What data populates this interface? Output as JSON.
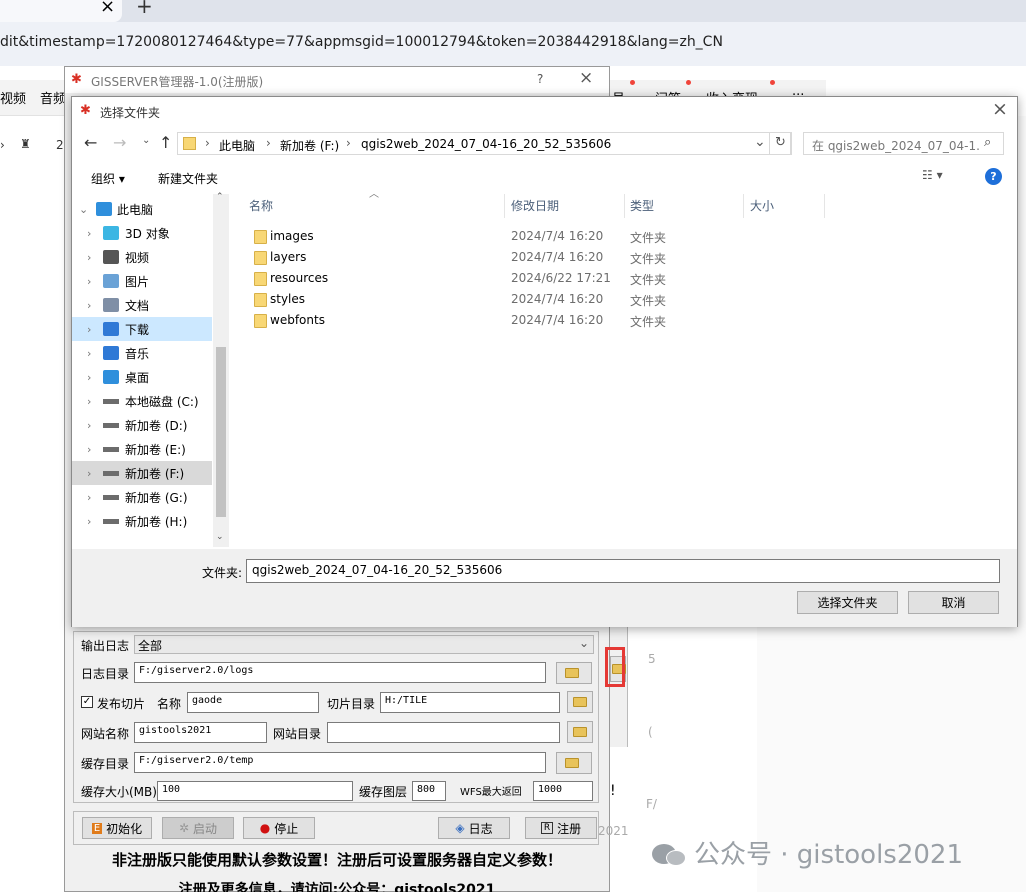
{
  "browser": {
    "tab_close": "×",
    "new_tab": "+",
    "url": "dit&timestamp=1720080127464&type=77&appmsgid=100012794&token=2038442918&lang=zh_CN",
    "nav_left": [
      "视频",
      "音频"
    ],
    "nav_right": [
      "号",
      "问答",
      "收入变现",
      "···"
    ],
    "toolbar_num": "2"
  },
  "gisserver": {
    "title": "GISSERVER管理器-1.0(注册版)",
    "help": "?",
    "close": "×",
    "log_output_label": "输出日志",
    "log_output_value": "全部",
    "log_dir_label": "日志目录",
    "log_dir_value": "F:/giserver2.0/logs",
    "publish_tiles_label": "发布切片",
    "name_label": "名称",
    "name_value": "gaode",
    "tile_dir_label": "切片目录",
    "tile_dir_value": "H:/TILE",
    "site_name_label": "网站名称",
    "site_name_value": "gistools2021",
    "site_dir_label": "网站目录",
    "site_dir_value": "",
    "cache_dir_label": "缓存目录",
    "cache_dir_value": "F:/giserver2.0/temp",
    "cache_size_label": "缓存大小(MB)",
    "cache_size_value": "100",
    "cache_layers_label": "缓存图层",
    "cache_layers_value": "800",
    "wfs_max_label": "WFS最大返回",
    "wfs_max_value": "1000",
    "btn_init": "初始化",
    "btn_start": "启动",
    "btn_stop": "停止",
    "btn_log": "日志",
    "btn_register": "注册",
    "notice": "非注册版只能使用默认参数设置！注册后可设置服务器自定义参数！",
    "notice2": "注册及更多信息，请访问:公众号：gistools2021"
  },
  "dialog": {
    "title": "选择文件夹",
    "close": "×",
    "breadcrumb": [
      "此电脑",
      "新加卷 (F:)",
      "qgis2web_2024_07_04-16_20_52_535606"
    ],
    "search_placeholder": "在 qgis2web_2024_07_04-1...",
    "organize": "组织",
    "new_folder": "新建文件夹",
    "help": "?",
    "tree": [
      {
        "label": "此电脑",
        "icon": "computer-icon"
      },
      {
        "label": "3D 对象",
        "icon": "cube-icon"
      },
      {
        "label": "视频",
        "icon": "video-icon"
      },
      {
        "label": "图片",
        "icon": "picture-icon"
      },
      {
        "label": "文档",
        "icon": "document-icon"
      },
      {
        "label": "下载",
        "icon": "download-icon"
      },
      {
        "label": "音乐",
        "icon": "music-icon"
      },
      {
        "label": "桌面",
        "icon": "desktop-icon"
      },
      {
        "label": "本地磁盘 (C:)",
        "icon": "drive-icon"
      },
      {
        "label": "新加卷 (D:)",
        "icon": "drive-icon"
      },
      {
        "label": "新加卷 (E:)",
        "icon": "drive-icon"
      },
      {
        "label": "新加卷 (F:)",
        "icon": "drive-icon"
      },
      {
        "label": "新加卷 (G:)",
        "icon": "drive-icon"
      },
      {
        "label": "新加卷 (H:)",
        "icon": "drive-icon"
      }
    ],
    "columns": {
      "name": "名称",
      "date": "修改日期",
      "type": "类型",
      "size": "大小"
    },
    "files": [
      {
        "name": "images",
        "date": "2024/7/4 16:20",
        "type": "文件夹"
      },
      {
        "name": "layers",
        "date": "2024/7/4 16:20",
        "type": "文件夹"
      },
      {
        "name": "resources",
        "date": "2024/6/22 17:21",
        "type": "文件夹"
      },
      {
        "name": "styles",
        "date": "2024/7/4 16:20",
        "type": "文件夹"
      },
      {
        "name": "webfonts",
        "date": "2024/7/4 16:20",
        "type": "文件夹"
      }
    ],
    "folder_label": "文件夹:",
    "folder_value": "qgis2web_2024_07_04-16_20_52_535606",
    "select_button": "选择文件夹",
    "cancel_button": "取消"
  },
  "background": {
    "side_num": "2021",
    "right_snips": [
      "5",
      "(",
      "!",
      "F/"
    ]
  },
  "watermark": "公众号 · gistools2021"
}
